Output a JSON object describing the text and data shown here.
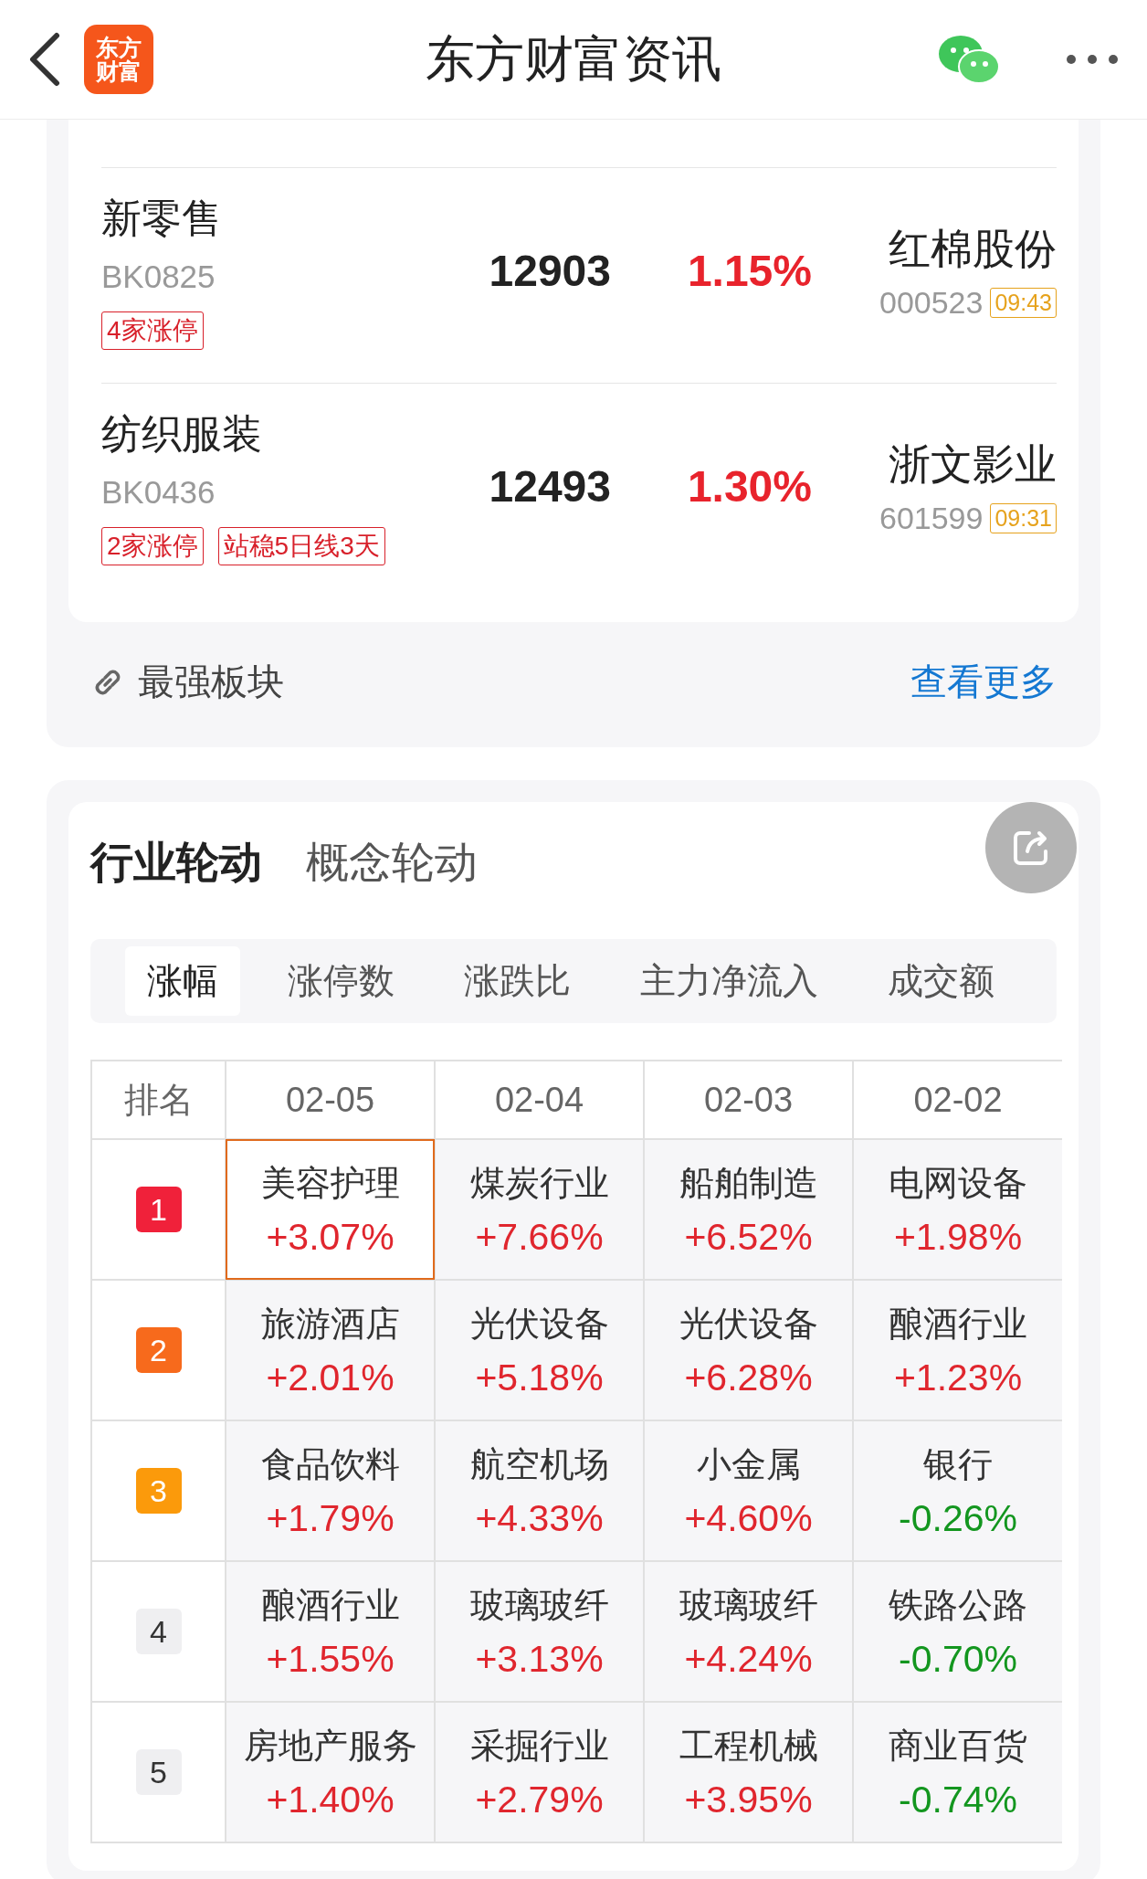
{
  "header": {
    "title": "东方财富资讯",
    "logo_lines": [
      "东方",
      "财富"
    ]
  },
  "sectors": [
    {
      "name": "新零售",
      "code": "BK0825",
      "value": "12903",
      "change": "1.15%",
      "tags": [
        "4家涨停"
      ],
      "stock_name": "红棉股份",
      "stock_code": "000523",
      "time": "09:43"
    },
    {
      "name": "纺织服装",
      "code": "BK0436",
      "value": "12493",
      "change": "1.30%",
      "tags": [
        "2家涨停",
        "站稳5日线3天"
      ],
      "stock_name": "浙文影业",
      "stock_code": "601599",
      "time": "09:31"
    }
  ],
  "sector_footer": {
    "title": "最强板块",
    "more": "查看更多"
  },
  "rotation": {
    "tabs": [
      {
        "label": "行业轮动",
        "selected": true
      },
      {
        "label": "概念轮动",
        "selected": false
      }
    ],
    "metrics": [
      {
        "label": "涨幅",
        "selected": true
      },
      {
        "label": "涨停数",
        "selected": false
      },
      {
        "label": "涨跌比",
        "selected": false
      },
      {
        "label": "主力净流入",
        "selected": false
      },
      {
        "label": "成交额",
        "selected": false
      }
    ],
    "table": {
      "columns": [
        "排名",
        "02-05",
        "02-04",
        "02-03",
        "02-02"
      ],
      "rows": [
        {
          "cells": [
            {
              "kind": "rank",
              "rank": "1",
              "color": "#f0213a"
            },
            {
              "kind": "sector",
              "name": "美容护理",
              "change": "+3.07%",
              "color": "#e0262e",
              "selected": true
            },
            {
              "kind": "sector",
              "name": "煤炭行业",
              "change": "+7.66%",
              "color": "#e0262e",
              "selected": false
            },
            {
              "kind": "sector",
              "name": "船舶制造",
              "change": "+6.52%",
              "color": "#e0262e",
              "selected": false
            },
            {
              "kind": "sector",
              "name": "电网设备",
              "change": "+1.98%",
              "color": "#e0262e",
              "selected": false
            }
          ]
        },
        {
          "cells": [
            {
              "kind": "rank",
              "rank": "2",
              "color": "#f76a1c"
            },
            {
              "kind": "sector",
              "name": "旅游酒店",
              "change": "+2.01%",
              "color": "#e0262e",
              "selected": false
            },
            {
              "kind": "sector",
              "name": "光伏设备",
              "change": "+5.18%",
              "color": "#e0262e",
              "selected": false
            },
            {
              "kind": "sector",
              "name": "光伏设备",
              "change": "+6.28%",
              "color": "#e0262e",
              "selected": false
            },
            {
              "kind": "sector",
              "name": "酿酒行业",
              "change": "+1.23%",
              "color": "#e0262e",
              "selected": false
            }
          ]
        },
        {
          "cells": [
            {
              "kind": "rank",
              "rank": "3",
              "color": "#fb9a0b"
            },
            {
              "kind": "sector",
              "name": "食品饮料",
              "change": "+1.79%",
              "color": "#e0262e",
              "selected": false
            },
            {
              "kind": "sector",
              "name": "航空机场",
              "change": "+4.33%",
              "color": "#e0262e",
              "selected": false
            },
            {
              "kind": "sector",
              "name": "小金属",
              "change": "+4.60%",
              "color": "#e0262e",
              "selected": false
            },
            {
              "kind": "sector",
              "name": "银行",
              "change": "-0.26%",
              "color": "#13961f",
              "selected": false
            }
          ]
        },
        {
          "cells": [
            {
              "kind": "rank",
              "rank": "4",
              "color": "#efeff1"
            },
            {
              "kind": "sector",
              "name": "酿酒行业",
              "change": "+1.55%",
              "color": "#e0262e",
              "selected": false
            },
            {
              "kind": "sector",
              "name": "玻璃玻纤",
              "change": "+3.13%",
              "color": "#e0262e",
              "selected": false
            },
            {
              "kind": "sector",
              "name": "玻璃玻纤",
              "change": "+4.24%",
              "color": "#e0262e",
              "selected": false
            },
            {
              "kind": "sector",
              "name": "铁路公路",
              "change": "-0.70%",
              "color": "#13961f",
              "selected": false
            }
          ]
        },
        {
          "cells": [
            {
              "kind": "rank",
              "rank": "5",
              "color": "#efeff1"
            },
            {
              "kind": "sector",
              "name": "房地产服务",
              "change": "+1.40%",
              "color": "#e0262e",
              "selected": false
            },
            {
              "kind": "sector",
              "name": "采掘行业",
              "change": "+2.79%",
              "color": "#e0262e",
              "selected": false
            },
            {
              "kind": "sector",
              "name": "工程机械",
              "change": "+3.95%",
              "color": "#e0262e",
              "selected": false
            },
            {
              "kind": "sector",
              "name": "商业百货",
              "change": "-0.74%",
              "color": "#13961f",
              "selected": false
            }
          ]
        }
      ]
    }
  }
}
